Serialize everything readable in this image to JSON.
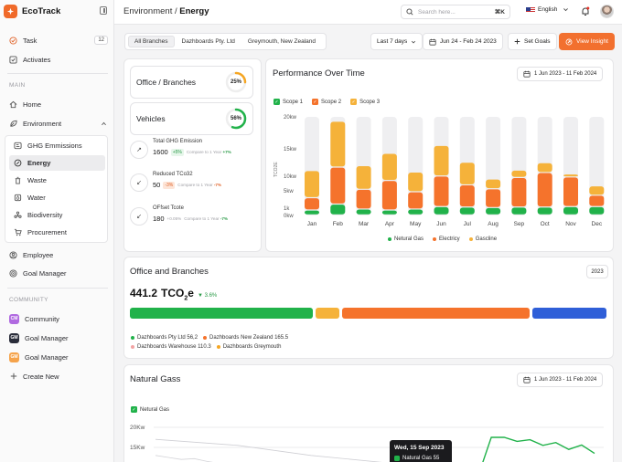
{
  "app": {
    "name": "EcoTrack"
  },
  "sidebar": {
    "task_label": "Task",
    "task_count": "12",
    "activates_label": "Activates",
    "main_section": "MAIN",
    "home_label": "Home",
    "environment_label": "Environment",
    "sub_items": [
      "GHG Emmissions",
      "Energy",
      "Waste",
      "Water",
      "Biodiversity",
      "Procurement"
    ],
    "employee_label": "Employee",
    "goal_manager_label": "Goal Manager",
    "community_section": "COMMUNITY",
    "community_items": [
      {
        "label": "Community",
        "badge": "CM",
        "color": "#b06ae0"
      },
      {
        "label": "Goal Manager",
        "badge": "GM",
        "color": "#2a2d3a"
      },
      {
        "label": "Goal Manager",
        "badge": "GM",
        "color": "#f5a34b"
      }
    ],
    "create_new_label": "Create New"
  },
  "topbar": {
    "breadcrumb_parent": "Environment",
    "breadcrumb_sep": " / ",
    "breadcrumb_current": "Energy",
    "search_placeholder": "Search here...",
    "search_shortcut": "⌘K",
    "language": "English"
  },
  "filters": {
    "tabs": [
      "All Branches",
      "Dazhboards Pty. Ltd",
      "Greymouth, New Zealand"
    ],
    "period": "Last 7 days",
    "date_range": "Jun 24 - Feb 24 2023",
    "set_goals": "Set Goals",
    "view_insight": "View Insight"
  },
  "summary": {
    "office_branches": {
      "label": "Office / Branches",
      "percent": 25,
      "percent_label": "25%"
    },
    "vehicles": {
      "label": "Vehicles",
      "percent": 56,
      "percent_label": "56%"
    },
    "metrics": [
      {
        "name": "Total GHG Emission",
        "value": "1600",
        "change": "+5%",
        "trend": "up",
        "compare": "Compare to 1 Year",
        "compare_value": "+7%"
      },
      {
        "name": "Reduced TCo32",
        "value": "50",
        "change": "-3%",
        "trend": "down",
        "compare": "Compare to 1 Year",
        "compare_value": "-7%"
      },
      {
        "name": "OFfset Tcote",
        "value": "180",
        "change": "+0.05%",
        "trend": "none",
        "compare": "Compare to 1 Year",
        "compare_value": "-7%"
      }
    ]
  },
  "performance": {
    "title": "Performance Over Time",
    "date_range": "1 Jun 2023 - 11 Feb 2024",
    "scope_legend": [
      "Scope 1",
      "Scope 2",
      "Scope 3"
    ],
    "bottom_legend": [
      "Netural Gas",
      "Electricy",
      "Gascline"
    ]
  },
  "office": {
    "title": "Office and Branches",
    "year": "2023",
    "value": "441.2",
    "unit_main": "TCO",
    "unit_sub": "2",
    "unit_tail": "e",
    "delta": "▼ 3.6%",
    "legend": [
      {
        "label": "Dazhboards Pty Ltd 56,2",
        "color": "#21b24a"
      },
      {
        "label": "Dazhboards New Zealand 165.5",
        "color": "#f5732c"
      },
      {
        "label": "Dazhboards Warehouse 110.3",
        "color": "#f2a3a3"
      },
      {
        "label": "Dazhboards Greymouth",
        "color": "#f5a623"
      }
    ]
  },
  "natural_gas": {
    "title": "Natural Gass",
    "date_range": "1 Jun 2023 - 11 Feb 2024",
    "legend": "Netural Gas",
    "tooltip_date": "Wed, 15 Sep 2023",
    "tooltip_label": "Natural Gas 55"
  },
  "chart_data": [
    {
      "type": "bar",
      "title": "Performance Over Time",
      "ylabel": "TCO2E",
      "y_ticks": [
        "0kw",
        "1k",
        "5kw",
        "10kw",
        "15kw",
        "20kw"
      ],
      "categories": [
        "Jan",
        "Feb",
        "Mar",
        "Apr",
        "May",
        "Jun",
        "Jul",
        "Aug",
        "Sep",
        "Oct",
        "Nov",
        "Dec"
      ],
      "series": [
        {
          "name": "Scope 1",
          "color": "#21b24a",
          "values": [
            1.0,
            2.2,
            1.2,
            1.0,
            1.2,
            1.7,
            1.6,
            1.5,
            1.6,
            1.6,
            1.7,
            1.7
          ]
        },
        {
          "name": "Scope 2",
          "color": "#f5732c",
          "values": [
            2.5,
            7.5,
            4.0,
            6.0,
            3.5,
            6.2,
            4.5,
            3.8,
            6.0,
            7.0,
            6.0,
            2.3
          ]
        },
        {
          "name": "Scope 3",
          "color": "#f5b23a",
          "values": [
            5.5,
            9.3,
            4.8,
            5.5,
            4.0,
            6.2,
            4.6,
            2.0,
            1.5,
            2.0,
            0.6,
            1.9
          ]
        }
      ]
    },
    {
      "type": "line",
      "title": "Natural Gass",
      "series": [
        {
          "name": "Netural Gas",
          "color": "#21b24a",
          "values": [
            13,
            12.5,
            12,
            12.2,
            11.5,
            11,
            10.8,
            10.5,
            10.2,
            9.8,
            9.5,
            9.2,
            9,
            8.7,
            8.5,
            8.2,
            8,
            8,
            8,
            8,
            8,
            8,
            8,
            8,
            8,
            8,
            17.5,
            17.5,
            16.5,
            16.9,
            15.5,
            16.2,
            14.5,
            15.6,
            13.5
          ]
        }
      ],
      "y_ticks": [
        "20Kw",
        "15Kw"
      ],
      "ylim": [
        0,
        20
      ]
    }
  ]
}
